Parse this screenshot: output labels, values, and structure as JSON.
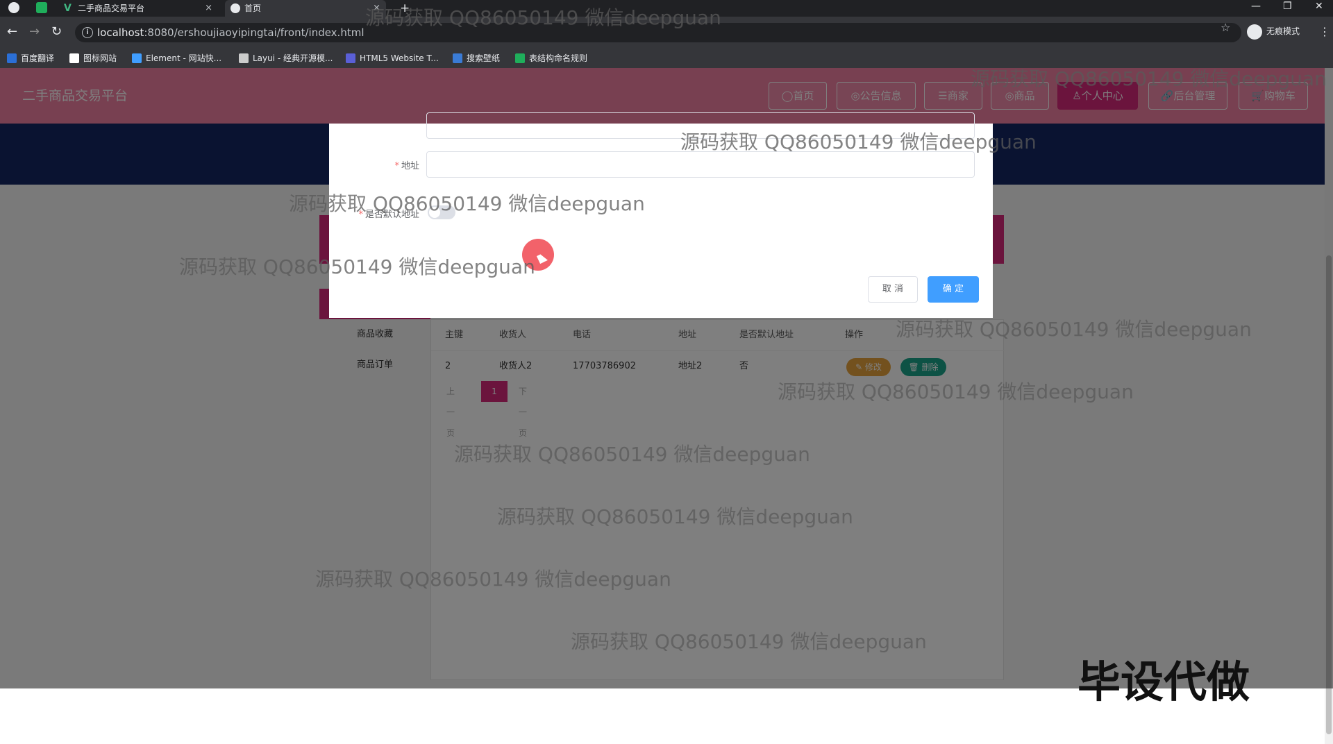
{
  "browser": {
    "tabs": [
      {
        "label": "二手商品交易平台",
        "close": "×"
      },
      {
        "label": "首页",
        "close": "×"
      }
    ],
    "new_tab": "+",
    "window_controls": [
      "—",
      "❐",
      "✕"
    ],
    "url_host": "localhost",
    "url_rest": ":8080/ershoujiaoyipingtai/front/index.html",
    "incognito_label": "无痕模式",
    "bookmarks": [
      {
        "label": "百度翻译",
        "color": "#2b6fd6"
      },
      {
        "label": "图标网站",
        "color": "#ffffff"
      },
      {
        "label": "Element - 网站快...",
        "color": "#409eff"
      },
      {
        "label": "Layui - 经典开源模...",
        "color": "#cccccc"
      },
      {
        "label": "HTML5 Website T...",
        "color": "#5a5fd6"
      },
      {
        "label": "搜索壁纸",
        "color": "#3a7bd5"
      },
      {
        "label": "表结构命名规则",
        "color": "#1fae5b"
      }
    ]
  },
  "site": {
    "title": "二手商品交易平台",
    "nav": [
      "◯首页",
      "◎公告信息",
      "☰商家",
      "◎商品",
      "♙个人中心",
      "🔗后台管理",
      "🛒购物车"
    ],
    "active_nav": 4
  },
  "side_menu": [
    "商品收藏",
    "商品订单"
  ],
  "table": {
    "headers": [
      "主键",
      "收货人",
      "电话",
      "地址",
      "是否默认地址",
      "操作"
    ],
    "rows": [
      {
        "id": "2",
        "name": "收货人2",
        "phone": "17703786902",
        "address": "地址2",
        "is_default": "否",
        "edit": "✎ 修改",
        "delete": "🗑 删除"
      }
    ],
    "pager": {
      "prev": "上一页",
      "current": "1",
      "next": "下一页"
    }
  },
  "dialog": {
    "address_label": "地址",
    "address_value": "",
    "default_label": "是否默认地址",
    "default_on": false,
    "cancel": "取 消",
    "confirm": "确 定"
  },
  "watermark_text": "源码获取 QQ86050149 微信deepguan",
  "corner_mark": "毕设代做",
  "colors": {
    "header": "#f081a3",
    "accent": "#d6287a",
    "banner": "#142663",
    "primary": "#409eff",
    "edit_btn": "#e6a23c",
    "delete_btn": "#1aa58a"
  }
}
